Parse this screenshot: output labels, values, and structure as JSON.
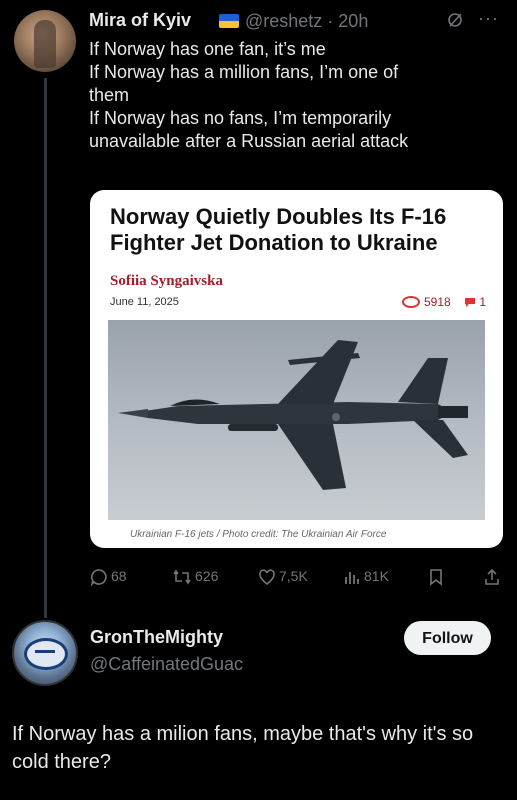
{
  "post": {
    "display_name": "Mira of Kyiv",
    "handle_time": "@reshetz · 20h",
    "more_label": "···",
    "lines": [
      "If Norway has one fan, it’s me",
      "If Norway has a million fans, I’m one of",
      "them",
      "If Norway has no fans, I’m temporarily",
      "unavailable after a Russian aerial attack"
    ],
    "card": {
      "headline": "Norway Quietly Doubles Its F-16 Fighter Jet Donation to Ukraine",
      "author": "Sofiia Syngaivska",
      "date": "June 11, 2025",
      "views": "5918",
      "comments": "1",
      "caption": "Ukrainian F-16 jets / Photo credit: The Ukrainian Air Force"
    },
    "actions": {
      "replies": "68",
      "reposts": "626",
      "likes": "7,5K",
      "views": "81K"
    }
  },
  "reply": {
    "display_name": "GronTheMighty",
    "handle": "@CaffeinatedGuac",
    "follow_label": "Follow",
    "text": "If Norway has a milion fans, maybe that's why it's so cold there?"
  },
  "colors": {
    "background": "#000000",
    "text": "#e7e9ea",
    "muted": "#71767b",
    "accent_red": "#a01d2c",
    "flag_blue": "#1e5fd6",
    "flag_yellow": "#f4c430"
  }
}
